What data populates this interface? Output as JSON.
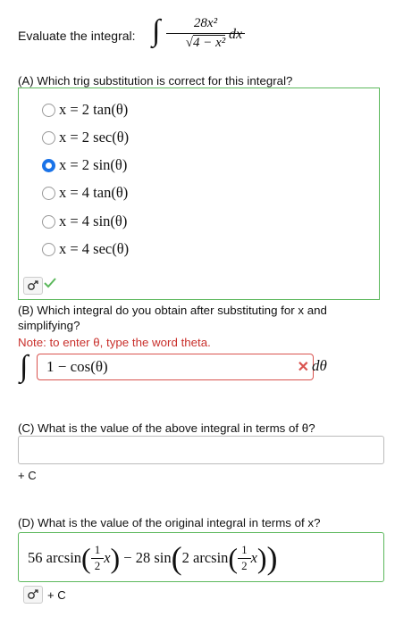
{
  "prompt": {
    "label": "Evaluate the integral:",
    "integrand_numerator": "28x²",
    "integrand_denominator_radicand": "4 − x²",
    "differential": "dx"
  },
  "partA": {
    "question": "(A) Which trig substitution is correct for this integral?",
    "options": [
      {
        "label": "x = 2 tan(θ)",
        "selected": false
      },
      {
        "label": "x = 2 sec(θ)",
        "selected": false
      },
      {
        "label": "x = 2 sin(θ)",
        "selected": true
      },
      {
        "label": "x = 4 tan(θ)",
        "selected": false
      },
      {
        "label": "x = 4 sin(θ)",
        "selected": false
      },
      {
        "label": "x = 4 sec(θ)",
        "selected": false
      }
    ],
    "status": "correct"
  },
  "partB": {
    "question": "(B) Which integral do you obtain after substituting for x and simplifying?",
    "question_line1": "(B) Which integral do you obtain after substituting for x and",
    "question_line2": "simplifying?",
    "note": "Note: to enter θ, type the word theta.",
    "input_value": "1 − cos(θ)",
    "differential": "dθ",
    "status": "incorrect"
  },
  "partC": {
    "question": "(C) What is the value of the above integral in terms of θ?",
    "input_value": "",
    "suffix": "+ C"
  },
  "partD": {
    "question": "(D) What is the value of the original integral in terms of x?",
    "answer": {
      "coef1": "56",
      "fn1": "arcsin",
      "frac_num": "1",
      "frac_den": "2",
      "var": "x",
      "minus": "−",
      "coef2": "28",
      "fn2": "sin",
      "inner_coef": "2",
      "fn3": "arcsin"
    },
    "suffix": "+ C"
  },
  "colors": {
    "correct": "#5cb85c",
    "incorrect": "#d9534f",
    "selected": "#1a73e8",
    "note": "#c9302c"
  }
}
